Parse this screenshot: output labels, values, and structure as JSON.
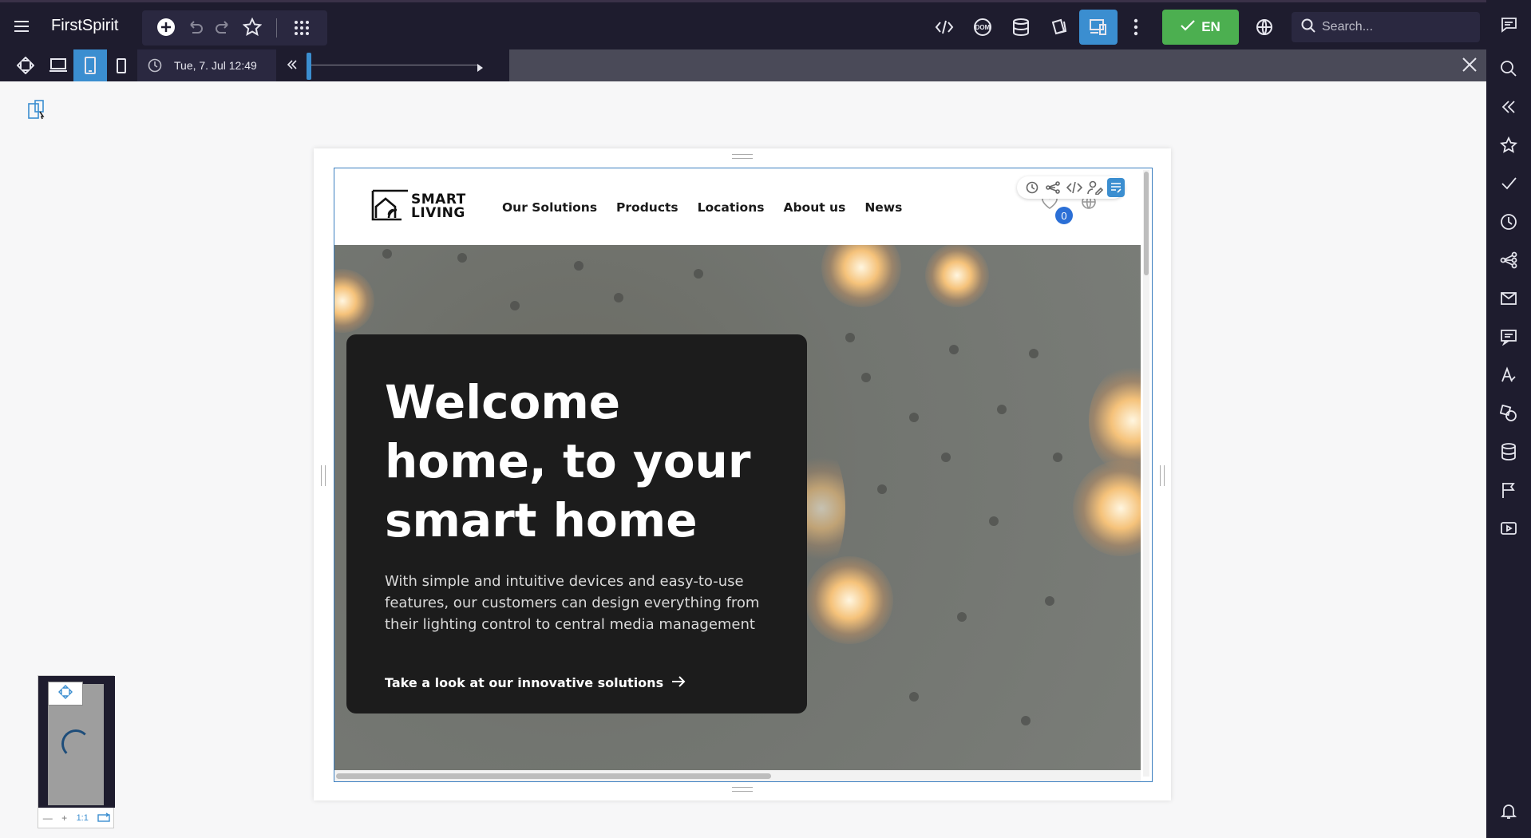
{
  "app": {
    "title": "FirstSpirit"
  },
  "search": {
    "placeholder": "Search..."
  },
  "language": {
    "label": "EN"
  },
  "subbar": {
    "date_prefix": "Tue, ",
    "date_main": "7. Jul 12:49"
  },
  "site": {
    "logo_line1": "SMART",
    "logo_line2": "LIVING",
    "nav": [
      "Our Solutions",
      "Products",
      "Locations",
      "About us",
      "News"
    ],
    "cart_count": "0"
  },
  "hero": {
    "title": "Welcome home, to your smart home",
    "text": "With simple and intuitive devices and easy-to-use features, our customers can design everything from their lighting control to central media management",
    "link": "Take a look at our innovative solutions"
  },
  "minimap": {
    "scale_label": "1:1"
  },
  "colors": {
    "accent": "#3b8ed0",
    "topbar": "#1e1c2e",
    "release": "#4caf50"
  }
}
